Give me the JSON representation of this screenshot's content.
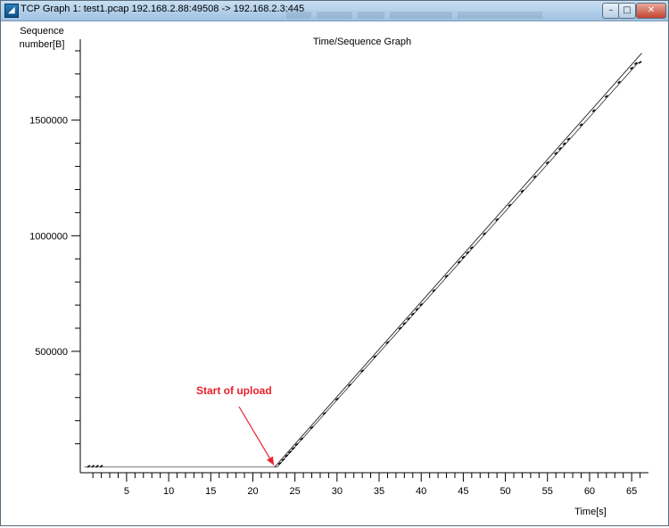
{
  "window": {
    "title": "TCP Graph 1: test1.pcap 192.168.2.88:49508 -> 192.168.2.3:445",
    "app_icon_glyph": "◢"
  },
  "controls": {
    "minimize": "–",
    "maximize": "□",
    "close": "✕"
  },
  "chart_data": {
    "type": "line",
    "title": "Time/Sequence Graph",
    "ylabel_line1": "Sequence",
    "ylabel_line2": "number[B]",
    "xlabel": "Time[s]",
    "xlim": [
      -0.5,
      67
    ],
    "ylim": [
      -25000,
      1850000
    ],
    "x_ticks": [
      5,
      10,
      15,
      20,
      25,
      30,
      35,
      40,
      45,
      50,
      55,
      60,
      65
    ],
    "y_ticks": [
      500000,
      1000000,
      1500000
    ],
    "grid": false,
    "annotation": {
      "text": "Start of upload",
      "color": "#e8202a",
      "points_to": {
        "x": 22.5,
        "y": 0
      }
    },
    "series": [
      {
        "x": [
          0,
          22.6,
          66.2
        ],
        "y": [
          0,
          0,
          1790000
        ]
      },
      {
        "x": [
          0,
          22.9,
          65.8
        ],
        "y": [
          0,
          0,
          1750000
        ]
      },
      {
        "x": [
          0,
          2,
          22.5
        ],
        "y": [
          0,
          0,
          0
        ]
      }
    ],
    "packets": {
      "x": [
        0.5,
        1.0,
        1.5,
        2.0,
        23.2,
        23.6,
        24.0,
        24.4,
        24.8,
        25.2,
        25.8,
        27.0,
        28.5,
        30.0,
        31.5,
        33.0,
        34.5,
        36.0,
        37.5,
        38.0,
        38.5,
        39.0,
        39.5,
        40.0,
        41.5,
        43.0,
        44.5,
        45.0,
        45.5,
        46.0,
        47.5,
        49.0,
        50.5,
        52.0,
        53.5,
        55.0,
        56.0,
        56.5,
        57.0,
        57.5,
        59.0,
        60.5,
        62.0,
        63.5,
        65.0,
        65.5,
        66.0
      ],
      "y": [
        3000,
        3000,
        3000,
        3000,
        15000,
        31000,
        48000,
        64000,
        80000,
        97000,
        121000,
        170000,
        231000,
        293000,
        354000,
        415000,
        477000,
        538000,
        600000,
        620000,
        641000,
        661000,
        682000,
        702000,
        763000,
        825000,
        886000,
        907000,
        927000,
        948000,
        1009000,
        1070000,
        1132000,
        1193000,
        1255000,
        1316000,
        1357000,
        1377000,
        1398000,
        1418000,
        1480000,
        1541000,
        1603000,
        1664000,
        1725000,
        1745000,
        1750000
      ]
    }
  }
}
